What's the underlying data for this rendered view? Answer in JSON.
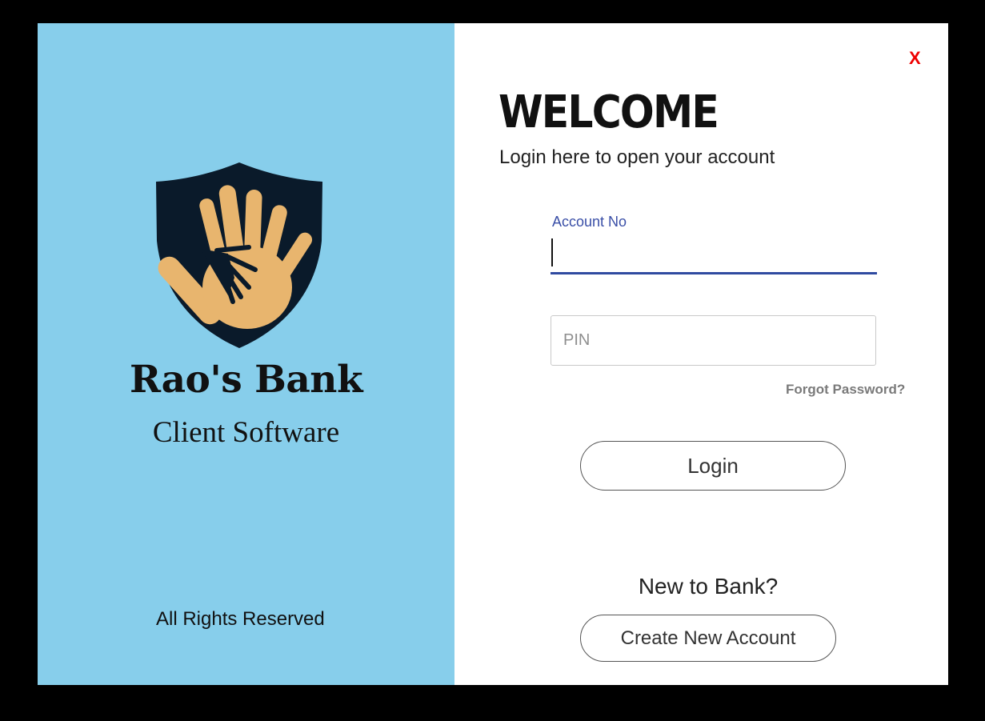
{
  "branding": {
    "bank_name": "Rao's Bank",
    "subtitle": "Client Software",
    "footer": "All Rights Reserved",
    "logo_icon": "shield-hands-icon",
    "panel_color": "#87ceeb"
  },
  "window": {
    "close_label": "X",
    "close_color": "#ee0000"
  },
  "login": {
    "heading": "WELCOME",
    "subheading": "Login here to open your account",
    "account_label": "Account No",
    "account_value": "",
    "pin_placeholder": "PIN",
    "pin_value": "",
    "forgot_label": "Forgot Password?",
    "login_label": "Login",
    "accent_color": "#2f4aa0"
  },
  "signup": {
    "prompt": "New to Bank?",
    "create_label": "Create New Account"
  }
}
